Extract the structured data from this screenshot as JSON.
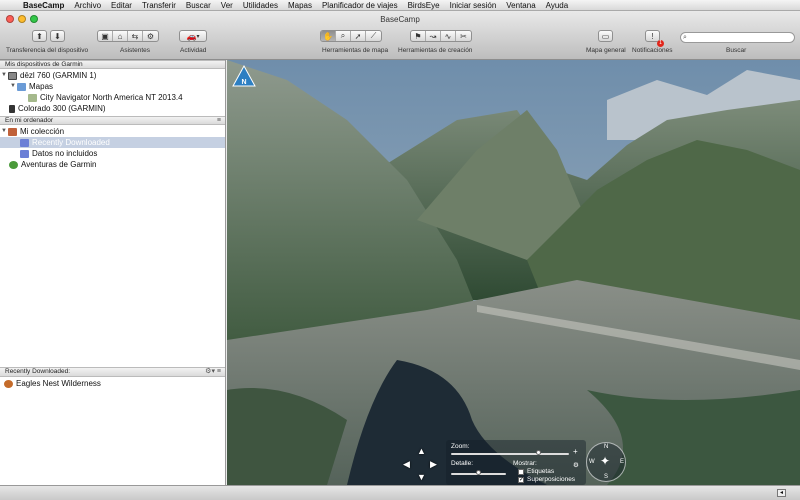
{
  "menubar": {
    "app": "BaseCamp",
    "items": [
      "Archivo",
      "Editar",
      "Transferir",
      "Buscar",
      "Ver",
      "Utilidades",
      "Mapas",
      "Planificador de viajes",
      "BirdsEye",
      "Iniciar sesión",
      "Ventana",
      "Ayuda"
    ]
  },
  "window": {
    "title": "BaseCamp"
  },
  "toolbar": {
    "transfer_label": "Transferencia del dispositivo",
    "assistants_label": "Asistentes",
    "activity_label": "Actividad",
    "map_tools_label": "Herramientas de mapa",
    "creation_tools_label": "Herramientas de creación",
    "overview_map_label": "Mapa general",
    "notifications_label": "Notificaciones",
    "notifications_count": "1",
    "search_label": "Buscar"
  },
  "sidebar": {
    "devices_header": "Mis dispositivos de Garmin",
    "devices": [
      {
        "label": "dēzl 760 (GARMIN 1)"
      },
      {
        "label": "Mapas"
      },
      {
        "label": "City Navigator North America NT 2013.4"
      },
      {
        "label": "Colorado 300 (GARMIN)"
      }
    ],
    "computer_header": "En mi ordenador",
    "computer_items": [
      {
        "label": "Mi colección"
      },
      {
        "label": "Recently Downloaded"
      },
      {
        "label": "Datos no incluidos"
      },
      {
        "label": "Aventuras de Garmin"
      }
    ],
    "list_header": "Recently Downloaded:",
    "list_items": [
      {
        "label": "Eagles Nest Wilderness"
      }
    ]
  },
  "map": {
    "compass_letter": "N",
    "zoom_label": "Zoom:",
    "detail_label": "Detalle:",
    "show_label": "Mostrar:",
    "labels_option": "Etiquetas",
    "labels_checked": false,
    "overlays_option": "Superposiciones",
    "overlays_checked": true,
    "rose": {
      "n": "N",
      "e": "E",
      "s": "S",
      "w": "W"
    }
  }
}
